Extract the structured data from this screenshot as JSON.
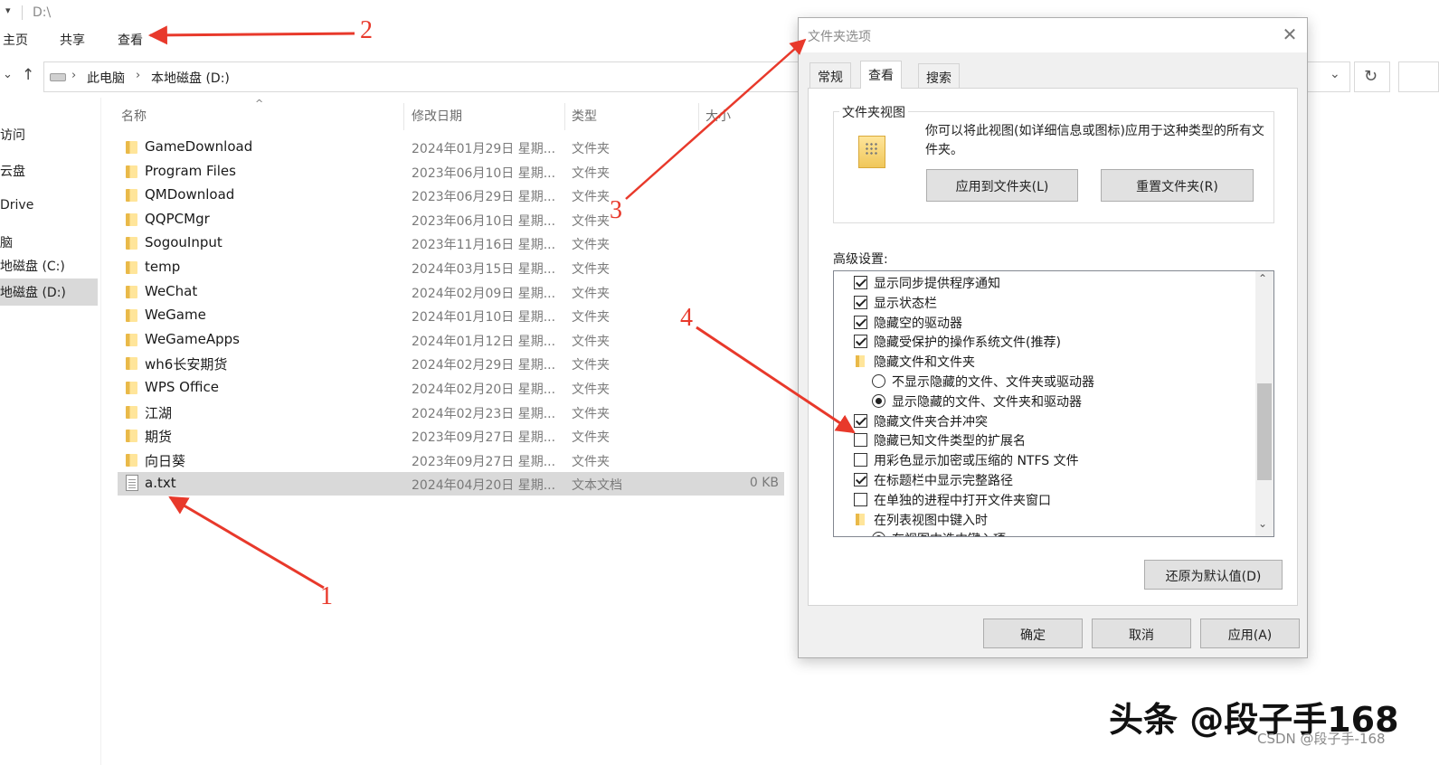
{
  "explorer": {
    "title_path": "D:\\",
    "ribbon_tabs": [
      "主页",
      "共享",
      "查看"
    ],
    "breadcrumb": [
      "此电脑",
      "本地磁盘 (D:)"
    ],
    "nav_pane": [
      "访问",
      "云盘",
      "Drive",
      "脑",
      "地磁盘 (C:)",
      "地磁盘 (D:)"
    ],
    "columns": {
      "name": "名称",
      "date": "修改日期",
      "type": "类型",
      "size": "大小"
    },
    "rows": [
      {
        "name": "GameDownload",
        "date": "2024年01月29日 星期...",
        "type": "文件夹",
        "size": "",
        "kind": "folder"
      },
      {
        "name": "Program Files",
        "date": "2023年06月10日 星期...",
        "type": "文件夹",
        "size": "",
        "kind": "folder"
      },
      {
        "name": "QMDownload",
        "date": "2023年06月29日 星期...",
        "type": "文件夹",
        "size": "",
        "kind": "folder"
      },
      {
        "name": "QQPCMgr",
        "date": "2023年06月10日 星期...",
        "type": "文件夹",
        "size": "",
        "kind": "folder"
      },
      {
        "name": "SogouInput",
        "date": "2023年11月16日 星期...",
        "type": "文件夹",
        "size": "",
        "kind": "folder"
      },
      {
        "name": "temp",
        "date": "2024年03月15日 星期...",
        "type": "文件夹",
        "size": "",
        "kind": "folder"
      },
      {
        "name": "WeChat",
        "date": "2024年02月09日 星期...",
        "type": "文件夹",
        "size": "",
        "kind": "folder"
      },
      {
        "name": "WeGame",
        "date": "2024年01月10日 星期...",
        "type": "文件夹",
        "size": "",
        "kind": "folder"
      },
      {
        "name": "WeGameApps",
        "date": "2024年01月12日 星期...",
        "type": "文件夹",
        "size": "",
        "kind": "folder"
      },
      {
        "name": "wh6长安期货",
        "date": "2024年02月29日 星期...",
        "type": "文件夹",
        "size": "",
        "kind": "folder"
      },
      {
        "name": "WPS Office",
        "date": "2024年02月20日 星期...",
        "type": "文件夹",
        "size": "",
        "kind": "folder"
      },
      {
        "name": "江湖",
        "date": "2024年02月23日 星期...",
        "type": "文件夹",
        "size": "",
        "kind": "folder"
      },
      {
        "name": "期货",
        "date": "2023年09月27日 星期...",
        "type": "文件夹",
        "size": "",
        "kind": "folder"
      },
      {
        "name": "向日葵",
        "date": "2023年09月27日 星期...",
        "type": "文件夹",
        "size": "",
        "kind": "folder"
      },
      {
        "name": "a.txt",
        "date": "2024年04月20日 星期...",
        "type": "文本文档",
        "size": "0 KB",
        "kind": "file"
      }
    ]
  },
  "dialog": {
    "title": "文件夹选项",
    "close_glyph": "✕",
    "tabs": [
      "常规",
      "查看",
      "搜索"
    ],
    "active_tab": "查看",
    "folder_view": {
      "legend": "文件夹视图",
      "description": "你可以将此视图(如详细信息或图标)应用于这种类型的所有文件夹。",
      "apply_button": "应用到文件夹(L)",
      "reset_button": "重置文件夹(R)"
    },
    "advanced_label": "高级设置:",
    "advanced_items": [
      {
        "kind": "checkbox",
        "checked": true,
        "label": "显示同步提供程序通知"
      },
      {
        "kind": "checkbox",
        "checked": true,
        "label": "显示状态栏"
      },
      {
        "kind": "checkbox",
        "checked": true,
        "label": "隐藏空的驱动器"
      },
      {
        "kind": "checkbox",
        "checked": true,
        "label": "隐藏受保护的操作系统文件(推荐)"
      },
      {
        "kind": "folder",
        "checked": false,
        "label": "隐藏文件和文件夹"
      },
      {
        "kind": "radio",
        "checked": false,
        "label": "不显示隐藏的文件、文件夹或驱动器"
      },
      {
        "kind": "radio",
        "checked": true,
        "label": "显示隐藏的文件、文件夹和驱动器"
      },
      {
        "kind": "checkbox",
        "checked": true,
        "label": "隐藏文件夹合并冲突"
      },
      {
        "kind": "checkbox",
        "checked": false,
        "label": "隐藏已知文件类型的扩展名"
      },
      {
        "kind": "checkbox",
        "checked": false,
        "label": "用彩色显示加密或压缩的 NTFS 文件"
      },
      {
        "kind": "checkbox",
        "checked": true,
        "label": "在标题栏中显示完整路径"
      },
      {
        "kind": "checkbox",
        "checked": false,
        "label": "在单独的进程中打开文件夹窗口"
      },
      {
        "kind": "folder",
        "checked": false,
        "label": "在列表视图中键入时"
      },
      {
        "kind": "radio",
        "checked": true,
        "label": "在视图中选中键入项"
      }
    ],
    "restore_defaults_button": "还原为默认值(D)",
    "ok_button": "确定",
    "cancel_button": "取消",
    "apply_button": "应用(A)"
  },
  "annotations": {
    "color": "#e8392b",
    "numbers": [
      "1",
      "2",
      "3",
      "4"
    ]
  },
  "watermark": {
    "main": "头条 @段子手168",
    "csdn": "CSDN @段子手-168"
  }
}
